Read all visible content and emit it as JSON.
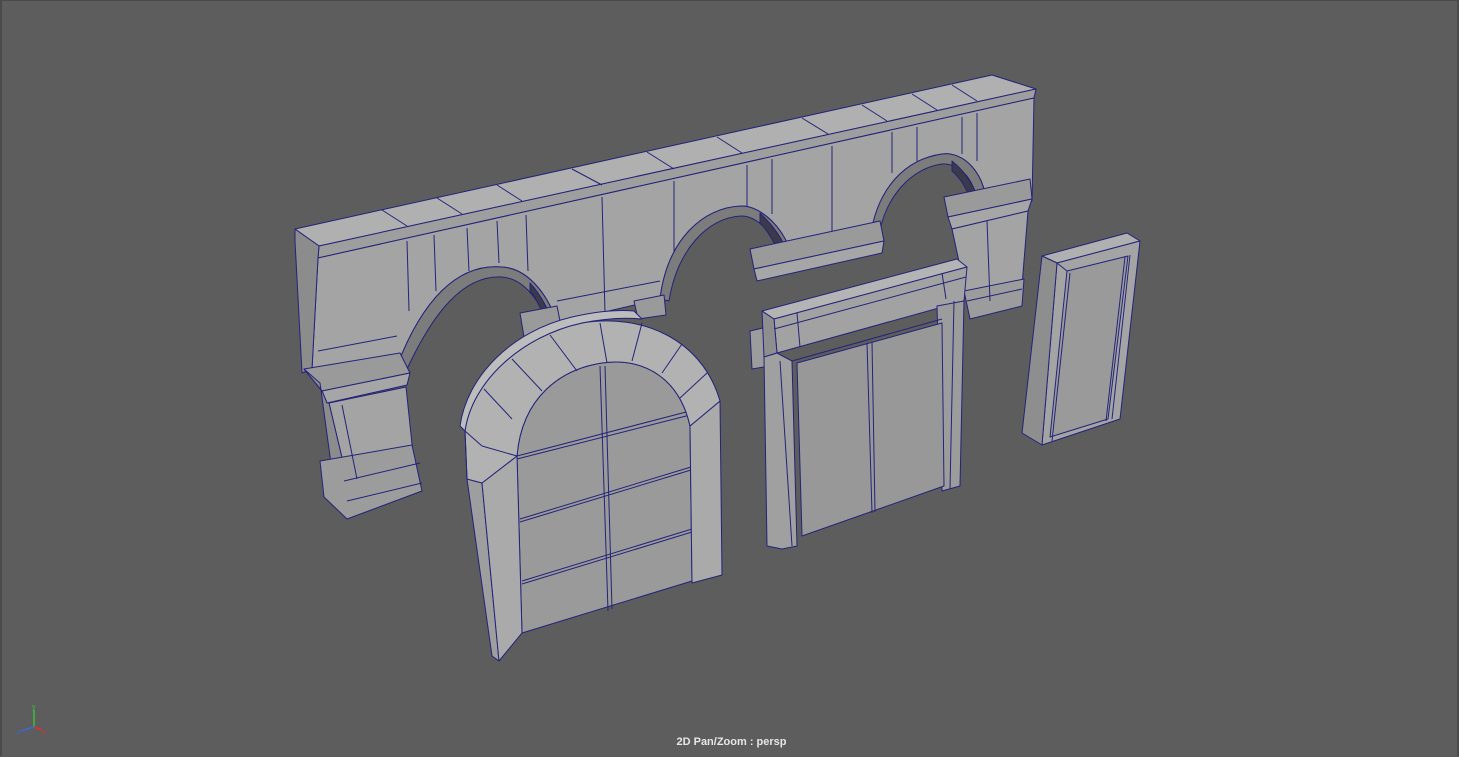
{
  "viewport": {
    "camera_label": "2D Pan/Zoom : persp",
    "background_color": "#5d5d5d",
    "wire_color": "#23237a",
    "mesh_light": "#a8a8a8",
    "mesh_mid": "#989898",
    "mesh_dark": "#8a8a8a"
  },
  "axis_gizmo": {
    "x_label": "x",
    "y_label": "y",
    "z_label": "z",
    "x_color": "#e03030",
    "y_color": "#3cc03c",
    "z_color": "#3a6ad8",
    "icon": "axis-gizmo-icon"
  },
  "objects": [
    "arched-wall-mesh",
    "arched-door-mesh",
    "rectangular-door-mesh",
    "door-frame-panel-mesh"
  ]
}
